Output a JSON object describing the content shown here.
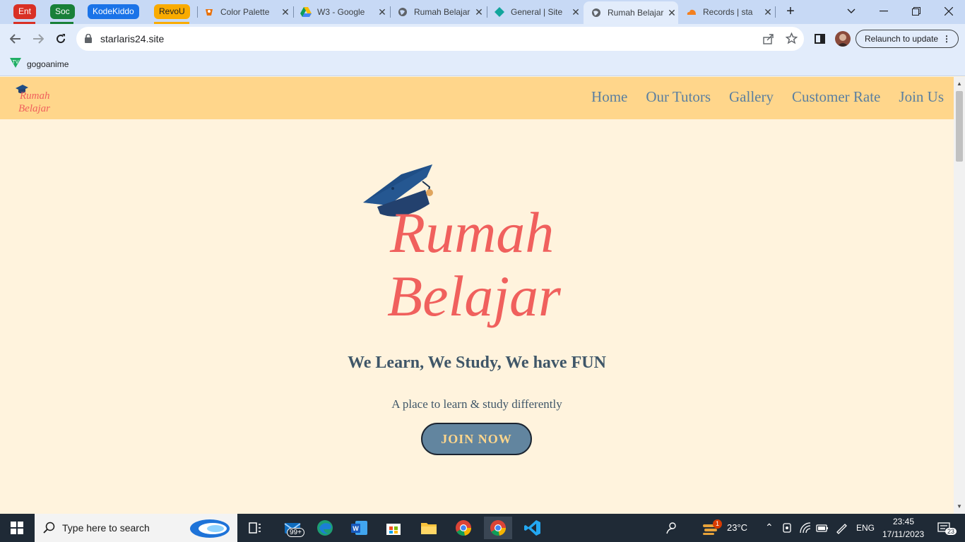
{
  "browser": {
    "tab_groups": [
      {
        "label": "Ent",
        "color": "#d93025"
      },
      {
        "label": "Soc",
        "color": "#188038"
      },
      {
        "label": "KodeKiddo",
        "color": "#1a73e8"
      },
      {
        "label": "RevoU",
        "color": "#f9ab00"
      }
    ],
    "tabs": [
      {
        "title": "Color Palette",
        "icon": "color-palette-favicon"
      },
      {
        "title": "W3 - Google",
        "icon": "google-drive-favicon"
      },
      {
        "title": "Rumah Belajar",
        "icon": "globe-favicon"
      },
      {
        "title": "General | Site",
        "icon": "site-favicon"
      },
      {
        "title": "Rumah Belajar",
        "icon": "globe-favicon",
        "active": true
      },
      {
        "title": "Records | sta",
        "icon": "cloudflare-favicon"
      }
    ],
    "url": "starlaris24.site",
    "relaunch_label": "Relaunch to update",
    "bookmark": "gogoanime"
  },
  "site": {
    "logo_text": [
      "Rumah",
      "Belajar"
    ],
    "nav": [
      "Home",
      "Our Tutors",
      "Gallery",
      "Customer Rate",
      "Join Us"
    ],
    "tagline": "We Learn, We Study, We have FUN",
    "subtitle": "A place to learn & study differently",
    "cta": "JOIN NOW"
  },
  "taskbar": {
    "search_placeholder": "Type here to search",
    "mail_badge": "99+",
    "weather_badge": "1",
    "temperature": "23°C",
    "language": "ENG",
    "time": "23:45",
    "date": "17/11/2023",
    "notifications": "23"
  },
  "colors": {
    "nav_bg": "#ffd68b",
    "page_bg": "#fff3dd",
    "logo_red": "#f0605d",
    "nav_text": "#5a7fa0",
    "heading": "#3f5668",
    "button_bg": "#62859f"
  }
}
